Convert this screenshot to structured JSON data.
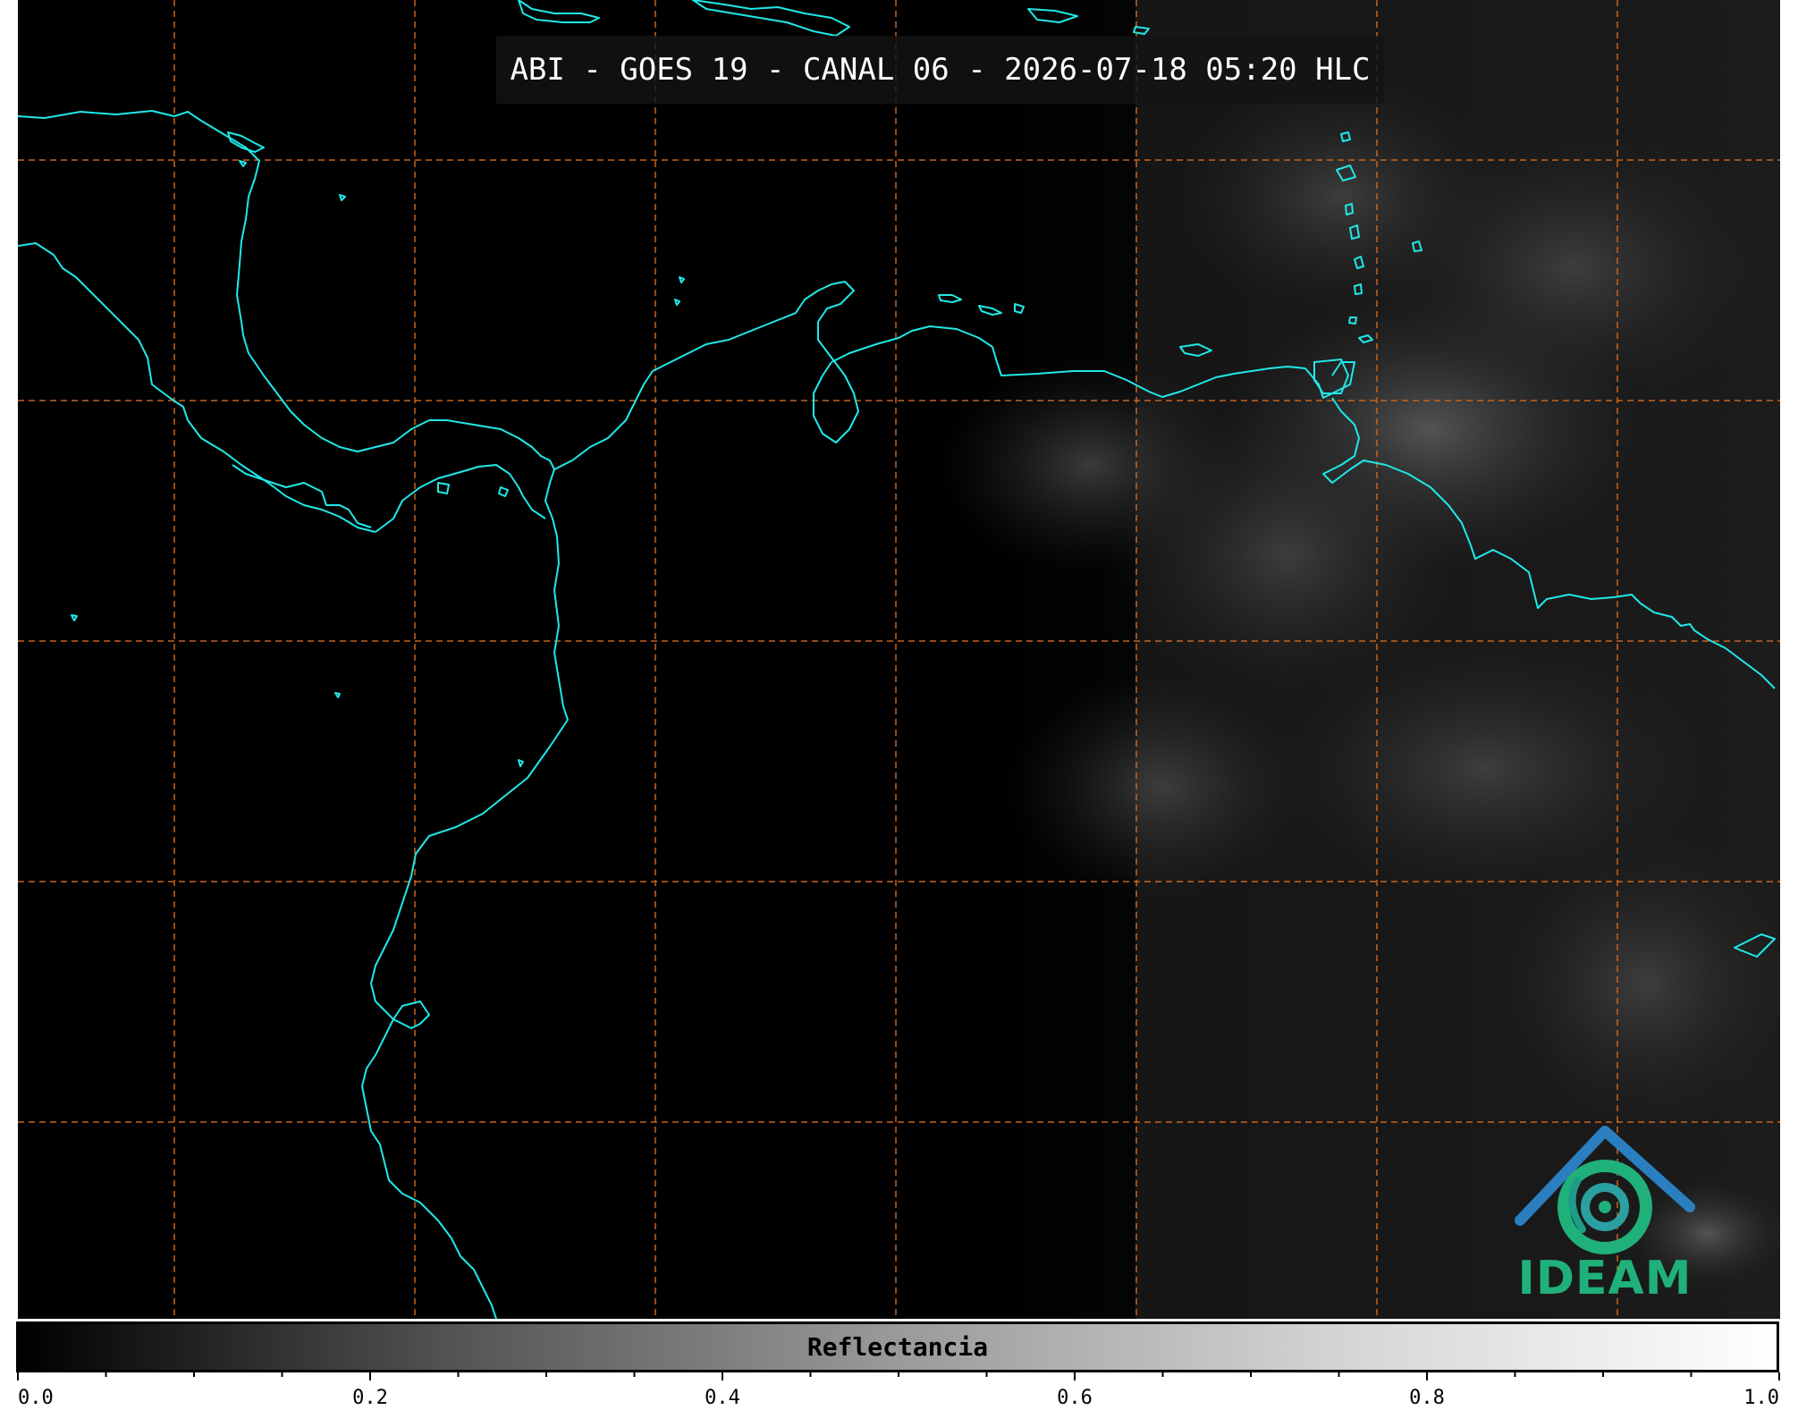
{
  "title": "ABI - GOES 19 - CANAL 06 - 2026-07-18 05:20 HLC",
  "colors": {
    "background": "#000000",
    "coastline": "#20e8e8",
    "gridline": "#c8641e",
    "title_box": "#141414",
    "logo_green": "#20b07a",
    "logo_blue": "#2a7fc0"
  },
  "logo": {
    "icon": "ideam-logo-icon",
    "text": "IDEAM"
  },
  "colorbar": {
    "label": "Reflectancia",
    "min": 0.0,
    "max": 1.0,
    "tick_labels": [
      "0.0",
      "0.2",
      "0.4",
      "0.6",
      "0.8",
      "1.0"
    ],
    "minor_ticks_between_labels": 3,
    "colormap": "grayscale"
  },
  "map": {
    "gridlines": "dashed",
    "meridian_count": 7,
    "parallel_count": 5
  }
}
